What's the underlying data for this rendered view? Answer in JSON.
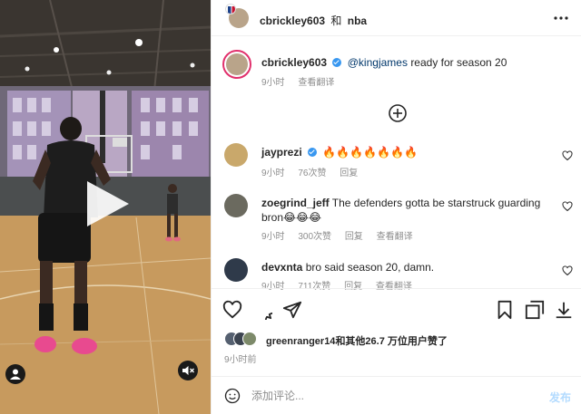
{
  "header": {
    "author": "cbrickley603",
    "joiner": "和",
    "coauthor": "nba"
  },
  "caption": {
    "username": "cbrickley603",
    "mention": "@kingjames",
    "text": "ready for season 20",
    "time": "9小时",
    "translate": "查看翻译"
  },
  "comments": [
    {
      "username": "jayprezi",
      "verified": true,
      "text": "🔥🔥🔥🔥🔥🔥🔥",
      "time": "9小时",
      "likes": "76次赞",
      "reply": "回复",
      "translate": ""
    },
    {
      "username": "zoegrind_jeff",
      "verified": false,
      "text": "The defenders gotta be starstruck guarding bron😂😂😂",
      "time": "9小时",
      "likes": "300次赞",
      "reply": "回复",
      "translate": "查看翻译"
    },
    {
      "username": "devxnta",
      "verified": false,
      "text": "bro said season 20, damn.",
      "time": "9小时",
      "likes": "711次赞",
      "reply": "回复",
      "translate": "查看翻译"
    }
  ],
  "likes": {
    "user": "greenranger14",
    "rest": "和其他26.7 万位用户赞了"
  },
  "post_time": "9小时前",
  "composer": {
    "placeholder": "添加评论...",
    "post_label": "发布"
  },
  "colors": {
    "accent": "#3897f0",
    "link": "#00376b",
    "muted": "#8e8e8e",
    "post_disabled": "#b3dbff"
  },
  "icons": {
    "video": [
      "play-icon",
      "user-tag-icon",
      "mute-icon"
    ],
    "actions": [
      "heart-icon",
      "comment-icon",
      "share-icon",
      "bookmark-icon",
      "collection-icon",
      "upload-icon"
    ],
    "header": "more-options-icon",
    "comments": "load-more-icon"
  }
}
